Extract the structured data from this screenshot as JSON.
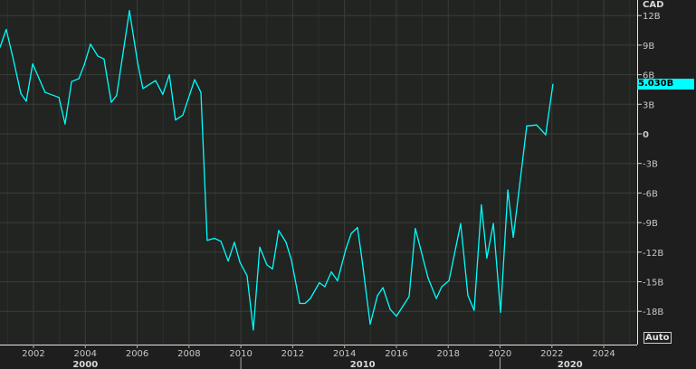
{
  "chart_data": {
    "type": "line",
    "title": "",
    "xlabel": "",
    "ylabel": "",
    "unit_label": "CAD",
    "current_value_label": "5.030B",
    "autoscale_label": "Auto",
    "line_color": "#00ffff",
    "ylim": [
      -20.5,
      13.5
    ],
    "xlim": [
      2000.7,
      2025.2
    ],
    "yticks": [
      {
        "v": 12,
        "label": "12B"
      },
      {
        "v": 9,
        "label": "9B"
      },
      {
        "v": 6,
        "label": "6B"
      },
      {
        "v": 3,
        "label": "3B"
      },
      {
        "v": 0,
        "label": "0"
      },
      {
        "v": -3,
        "label": "-3B"
      },
      {
        "v": -6,
        "label": "-6B"
      },
      {
        "v": -9,
        "label": "-9B"
      },
      {
        "v": -12,
        "label": "-12B"
      },
      {
        "v": -15,
        "label": "-15B"
      },
      {
        "v": -18,
        "label": "-18B"
      }
    ],
    "xticks": [
      {
        "v": 2002,
        "label": "2002"
      },
      {
        "v": 2004,
        "label": "2004"
      },
      {
        "v": 2006,
        "label": "2006"
      },
      {
        "v": 2008,
        "label": "2008"
      },
      {
        "v": 2010,
        "label": "2010"
      },
      {
        "v": 2012,
        "label": "2012"
      },
      {
        "v": 2014,
        "label": "2014"
      },
      {
        "v": 2016,
        "label": "2016"
      },
      {
        "v": 2018,
        "label": "2018"
      },
      {
        "v": 2020,
        "label": "2020"
      },
      {
        "v": 2022,
        "label": "2022"
      },
      {
        "v": 2024,
        "label": "2024"
      }
    ],
    "decades": [
      {
        "v": 2000,
        "label": "2000",
        "center": 2004.0
      },
      {
        "v": 2010,
        "label": "2010",
        "center": 2014.7
      },
      {
        "v": 2020,
        "label": "2020",
        "center": 2022.7
      }
    ],
    "grid": true,
    "series": [
      {
        "name": "CAD",
        "x": [
          2000.71,
          2000.95,
          2001.2,
          2001.51,
          2001.72,
          2001.97,
          2002.45,
          2002.98,
          2003.22,
          2003.47,
          2003.75,
          2003.96,
          2004.2,
          2004.48,
          2004.72,
          2005.0,
          2005.21,
          2005.7,
          2006.02,
          2006.22,
          2006.71,
          2006.99,
          2007.24,
          2007.48,
          2007.76,
          2008.22,
          2008.46,
          2008.7,
          2008.98,
          2009.23,
          2009.51,
          2009.75,
          2009.96,
          2010.24,
          2010.48,
          2010.73,
          2011.01,
          2011.22,
          2011.46,
          2011.74,
          2011.95,
          2012.27,
          2012.47,
          2012.68,
          2013.03,
          2013.24,
          2013.49,
          2013.73,
          2014.05,
          2014.26,
          2014.5,
          2014.67,
          2014.99,
          2015.27,
          2015.48,
          2015.76,
          2016.0,
          2016.49,
          2016.73,
          2017.22,
          2017.54,
          2017.75,
          2018.03,
          2018.48,
          2018.76,
          2019.0,
          2019.28,
          2019.49,
          2019.74,
          2020.02,
          2020.3,
          2020.51,
          2020.72,
          2021.03,
          2021.41,
          2021.76,
          2022.04
        ],
        "values": [
          8.8,
          10.6,
          7.8,
          4.1,
          3.3,
          7.1,
          4.2,
          3.7,
          1.0,
          5.3,
          5.6,
          7.0,
          9.1,
          7.9,
          7.6,
          3.2,
          3.9,
          12.5,
          7.2,
          4.6,
          5.4,
          4.0,
          6.0,
          1.4,
          1.9,
          5.5,
          4.2,
          -10.8,
          -10.6,
          -10.9,
          -12.9,
          -11.0,
          -13.0,
          -14.4,
          -19.9,
          -11.5,
          -13.3,
          -13.7,
          -9.8,
          -11.0,
          -12.8,
          -17.2,
          -17.2,
          -16.7,
          -15.1,
          -15.5,
          -14.0,
          -14.9,
          -11.7,
          -10.1,
          -9.5,
          -12.7,
          -19.3,
          -16.4,
          -15.6,
          -17.8,
          -18.5,
          -16.5,
          -9.6,
          -14.6,
          -16.7,
          -15.5,
          -14.9,
          -9.1,
          -16.4,
          -17.9,
          -7.2,
          -12.6,
          -9.1,
          -18.1,
          -5.7,
          -10.5,
          -6.0,
          0.8,
          0.9,
          -0.1,
          5.03
        ]
      }
    ]
  }
}
